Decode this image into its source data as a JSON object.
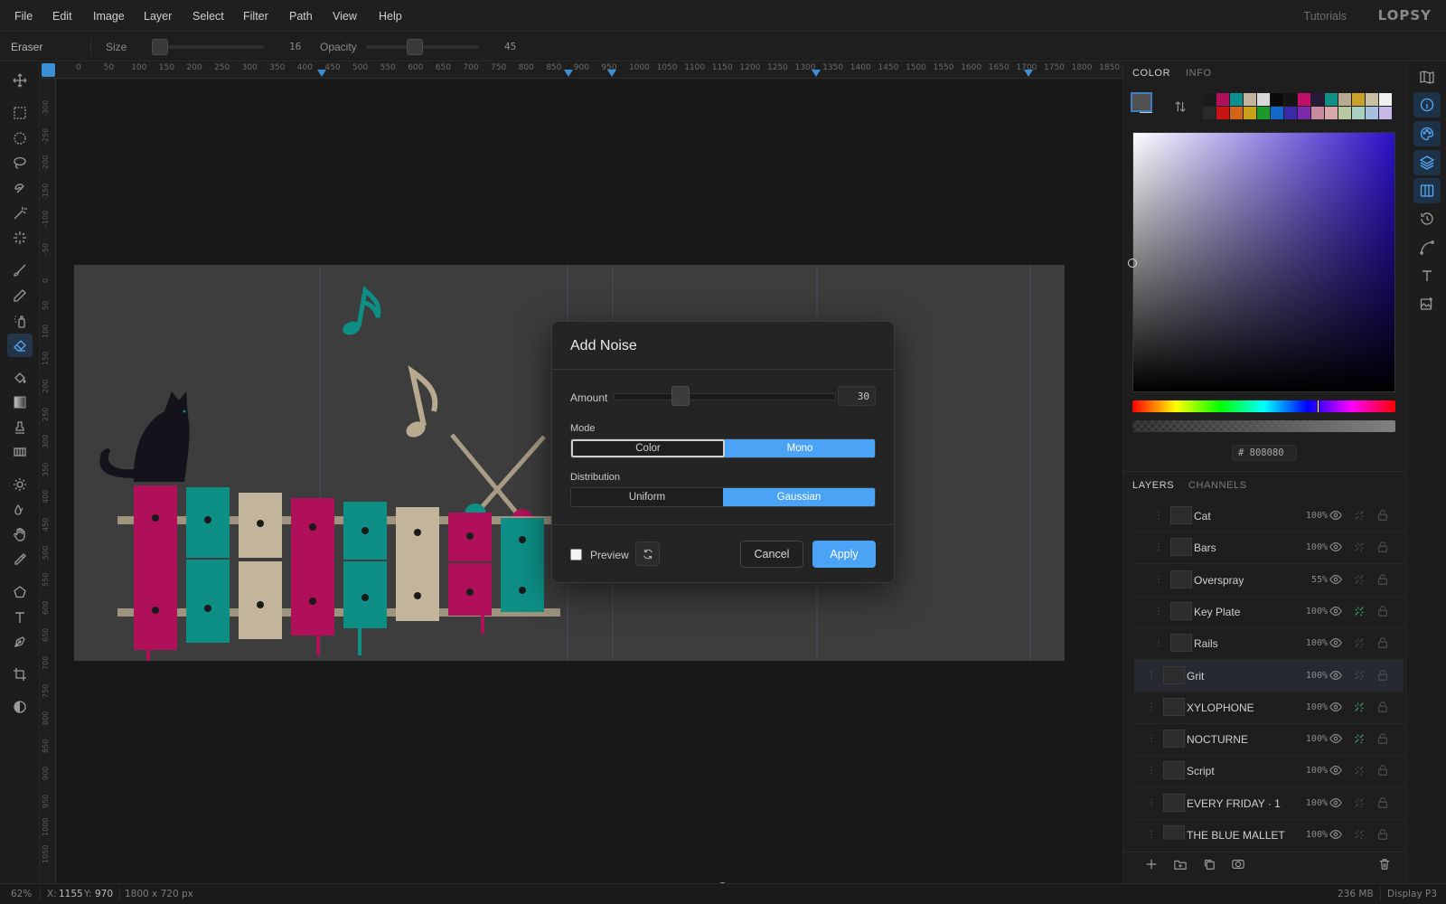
{
  "menu": {
    "items": [
      "File",
      "Edit",
      "Image",
      "Layer",
      "Select",
      "Filter",
      "Path",
      "View",
      "Help"
    ],
    "tutorials_label": "Tutorials",
    "logo_text": "LOPSY"
  },
  "options_bar": {
    "tool_name": "Eraser",
    "size_label": "Size",
    "size_value": "16",
    "opacity_label": "Opacity",
    "opacity_value": "45"
  },
  "ruler": {
    "top_labels": [
      "0",
      "50",
      "100",
      "150",
      "200",
      "250",
      "300",
      "350",
      "400",
      "450",
      "500",
      "550",
      "600",
      "650",
      "700",
      "750",
      "800",
      "850",
      "900",
      "950",
      "1000",
      "1050",
      "1100",
      "1150",
      "1200",
      "1250",
      "1300",
      "1350",
      "1400",
      "1450",
      "1500",
      "1550",
      "1600",
      "1650",
      "1700",
      "1750",
      "1800",
      "1850"
    ],
    "left_labels": [
      "-300",
      "-250",
      "-200",
      "-150",
      "-100",
      "-50",
      "0",
      "50",
      "100",
      "150",
      "200",
      "250",
      "300",
      "350",
      "400",
      "450",
      "500",
      "550",
      "600",
      "650",
      "700",
      "750",
      "800",
      "850",
      "900",
      "950",
      "1000",
      "1050"
    ]
  },
  "dialog": {
    "title": "Add Noise",
    "amount_label": "Amount",
    "amount_value": "30",
    "amount_fraction": 0.3,
    "mode_label": "Mode",
    "mode_options": [
      "Color",
      "Mono"
    ],
    "mode_selected": "Mono",
    "distribution_label": "Distribution",
    "distribution_options": [
      "Uniform",
      "Gaussian"
    ],
    "distribution_selected": "Gaussian",
    "preview_label": "Preview",
    "preview_checked": false,
    "cancel_label": "Cancel",
    "apply_label": "Apply"
  },
  "color_panel": {
    "tabs": [
      "COLOR",
      "INFO"
    ],
    "active_tab": "COLOR",
    "hex_prefix": "#",
    "hex_value": "808080",
    "swatches_row1": [
      "#1a1a1a",
      "#b0105a",
      "#0d8f8f",
      "#c2b59b",
      "#d8d8d8",
      "#0a0a0a",
      "#141414",
      "#c0106a",
      "#2a1a3a",
      "#0f8f86",
      "#b8a88f",
      "#c9a22a",
      "#c8c0a0",
      "#f0f0f0"
    ],
    "swatches_row2": [
      "#2a2a2a",
      "#c81414",
      "#d4631a",
      "#c9a018",
      "#1a9a2a",
      "#1466c8",
      "#3a2aa8",
      "#7a2aa8",
      "#c88aa0",
      "#d8a8a8",
      "#b8c8a0",
      "#a8d0c0",
      "#a8c0e0",
      "#c8b8e8"
    ]
  },
  "layers_panel": {
    "tabs": [
      "LAYERS",
      "CHANNELS"
    ],
    "active_tab": "LAYERS",
    "layers": [
      {
        "name": "Cat",
        "opacity": "100%",
        "indent": true,
        "green": false,
        "selected": false
      },
      {
        "name": "Bars",
        "opacity": "100%",
        "indent": true,
        "green": false,
        "selected": false
      },
      {
        "name": "Overspray",
        "opacity": "55%",
        "indent": true,
        "green": false,
        "selected": false
      },
      {
        "name": "Key Plate",
        "opacity": "100%",
        "indent": true,
        "green": true,
        "selected": false
      },
      {
        "name": "Rails",
        "opacity": "100%",
        "indent": true,
        "green": false,
        "selected": false
      },
      {
        "name": "Grit",
        "opacity": "100%",
        "indent": false,
        "green": false,
        "selected": true
      },
      {
        "name": "XYLOPHONE",
        "opacity": "100%",
        "indent": false,
        "green": true,
        "selected": false
      },
      {
        "name": "NOCTURNE",
        "opacity": "100%",
        "indent": false,
        "green": true,
        "selected": false
      },
      {
        "name": "Script",
        "opacity": "100%",
        "indent": false,
        "green": false,
        "selected": false
      },
      {
        "name": "EVERY FRIDAY · 1",
        "opacity": "100%",
        "indent": false,
        "green": false,
        "selected": false
      },
      {
        "name": "THE BLUE MALLET",
        "opacity": "100%",
        "indent": false,
        "green": false,
        "selected": false
      }
    ]
  },
  "status": {
    "zoom": "62%",
    "x_label": "X:",
    "x_value": "1155",
    "y_label": "Y:",
    "y_value": "970",
    "doc_size": "1800 x 720 px",
    "memory": "236 MB",
    "color_profile": "Display P3"
  },
  "colors": {
    "accent": "#4ba3f5",
    "magenta": "#b0105a",
    "teal": "#0d8f86",
    "beige": "#c2b59b"
  }
}
